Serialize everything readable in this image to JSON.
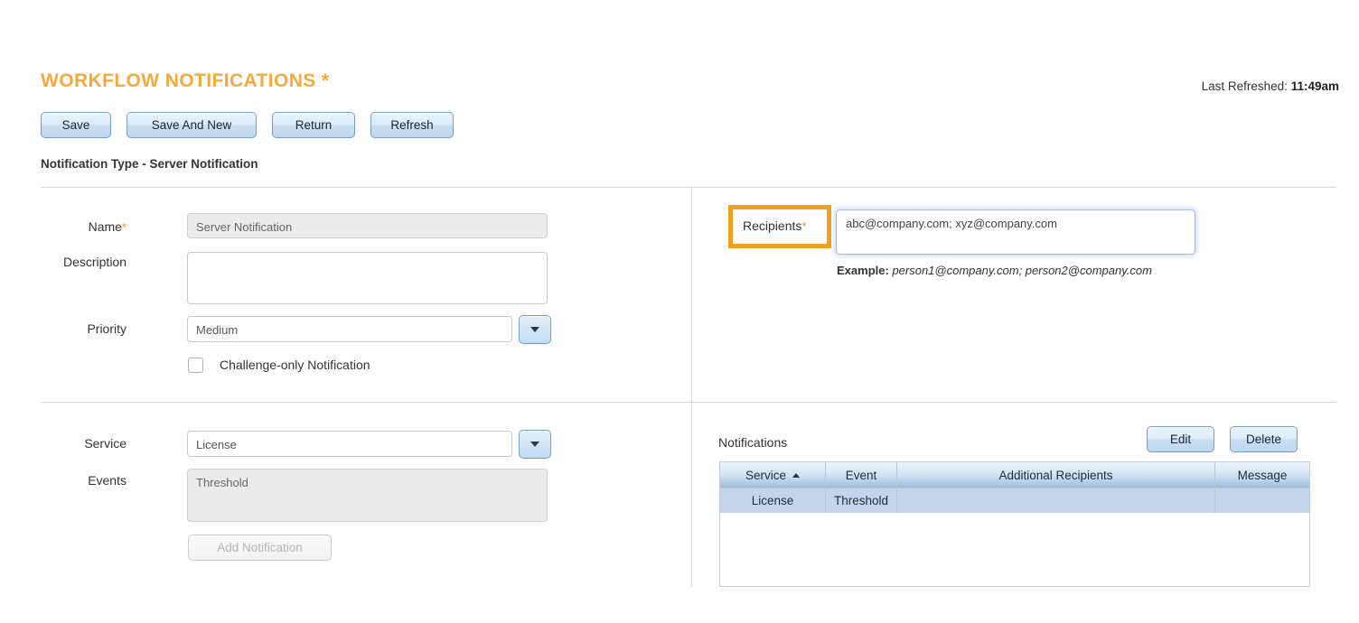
{
  "header": {
    "title": "WORKFLOW NOTIFICATIONS *",
    "last_refreshed_label": "Last Refreshed:",
    "last_refreshed_value": "11:49am",
    "subtitle": "Notification Type - Server Notification"
  },
  "toolbar": {
    "save_label": "Save",
    "save_and_new_label": "Save And New",
    "return_label": "Return",
    "refresh_label": "Refresh"
  },
  "form": {
    "name_label": "Name",
    "name_required_mark": "*",
    "name_value": "Server Notification",
    "description_label": "Description",
    "description_value": "",
    "priority_label": "Priority",
    "priority_value": "Medium",
    "challenge_only_label": "Challenge-only Notification",
    "challenge_only_checked": false,
    "service_label": "Service",
    "service_value": "License",
    "events_label": "Events",
    "events_value": "Threshold",
    "add_notification_label": "Add Notification",
    "add_notification_disabled": true
  },
  "recipients": {
    "label": "Recipients",
    "required_mark": "*",
    "value": "abc@company.com; xyz@company.com",
    "example_label": "Example:",
    "example_value": "person1@company.com; person2@company.com",
    "highlight_color": "#f0a01e"
  },
  "notifications": {
    "caption": "Notifications",
    "edit_label": "Edit",
    "delete_label": "Delete",
    "columns": [
      "Service",
      "Event",
      "Additional Recipients",
      "Message"
    ],
    "sorted_column": "Service",
    "sort_direction": "asc",
    "rows": [
      {
        "service": "License",
        "event": "Threshold",
        "additional_recipients": "",
        "message": "",
        "selected": true
      }
    ]
  },
  "colors": {
    "title": "#f5a93c",
    "accent_highlight": "#f0a01e",
    "table_header_top": "#eaf2fa",
    "table_header_bottom": "#9dbcdf",
    "row_selected": "#c3d5ea",
    "button_border": "#7a9cc0"
  }
}
